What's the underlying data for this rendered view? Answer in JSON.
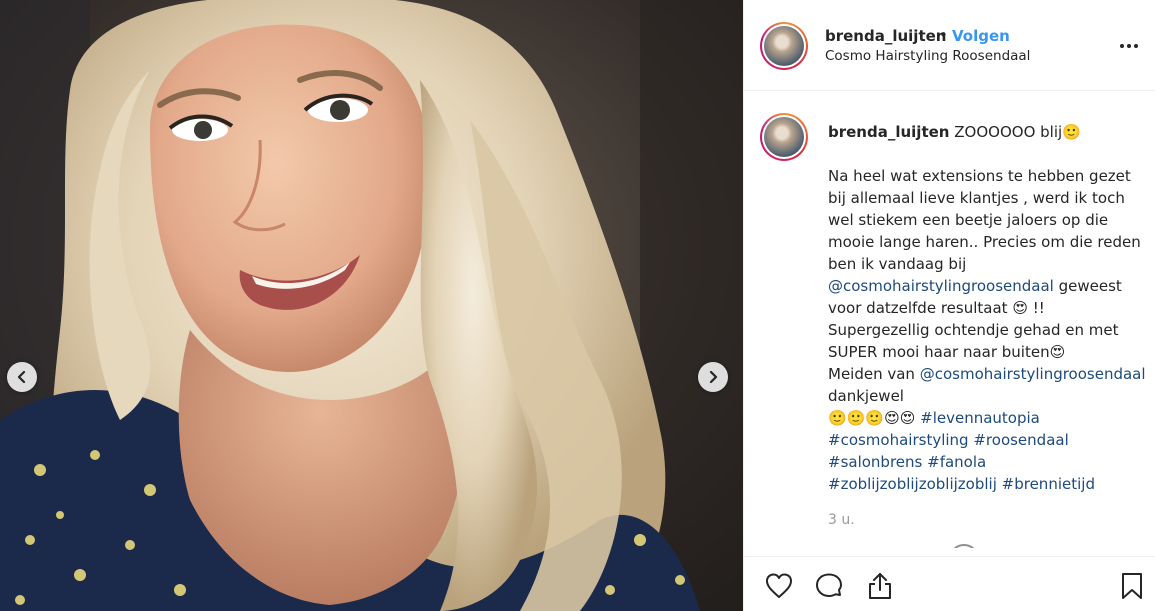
{
  "post": {
    "username": "brenda_luijten",
    "dot": "•",
    "follow_label": "Volgen",
    "location": "Cosmo Hairstyling Roosendaal",
    "caption": {
      "intro": "ZOOOOOO blij",
      "line1": "Na heel wat extensions te hebben gezet bij allemaal lieve klantjes , werd ik toch wel stiekem een beetje jaloers op die mooie lange haren.. Precies om die reden ben ik vandaag bij ",
      "mention1": "@cosmohairstylingroosendaal",
      "line2": " geweest voor datzelfde resultaat ",
      "line2_end": " !! Supergezellig ochtendje gehad en met SUPER mooi haar naar buiten",
      "line3": "Meiden van ",
      "mention2": "@cosmohairstylingroosendaal",
      "line3_end": " dankjewel",
      "hashtags": [
        "#levennautopia",
        "#cosmohairstyling",
        "#roosendaal",
        "#salonbrens",
        "#fanola",
        "#zoblijzoblijzoblijzoblij",
        "#brennietijd"
      ],
      "emoji_smile": "🙂",
      "emoji_hearteyes": "😍"
    },
    "timestamp": "3 u."
  },
  "colors": {
    "link": "#1e4a7e",
    "follow": "#3897f0",
    "text": "#262626",
    "muted": "#999999"
  },
  "icons": {
    "prev": "chevron-left-icon",
    "next": "chevron-right-icon",
    "more": "more-horizontal-icon",
    "like": "heart-icon",
    "comment": "comment-bubble-icon",
    "share": "share-icon",
    "save": "bookmark-icon"
  }
}
